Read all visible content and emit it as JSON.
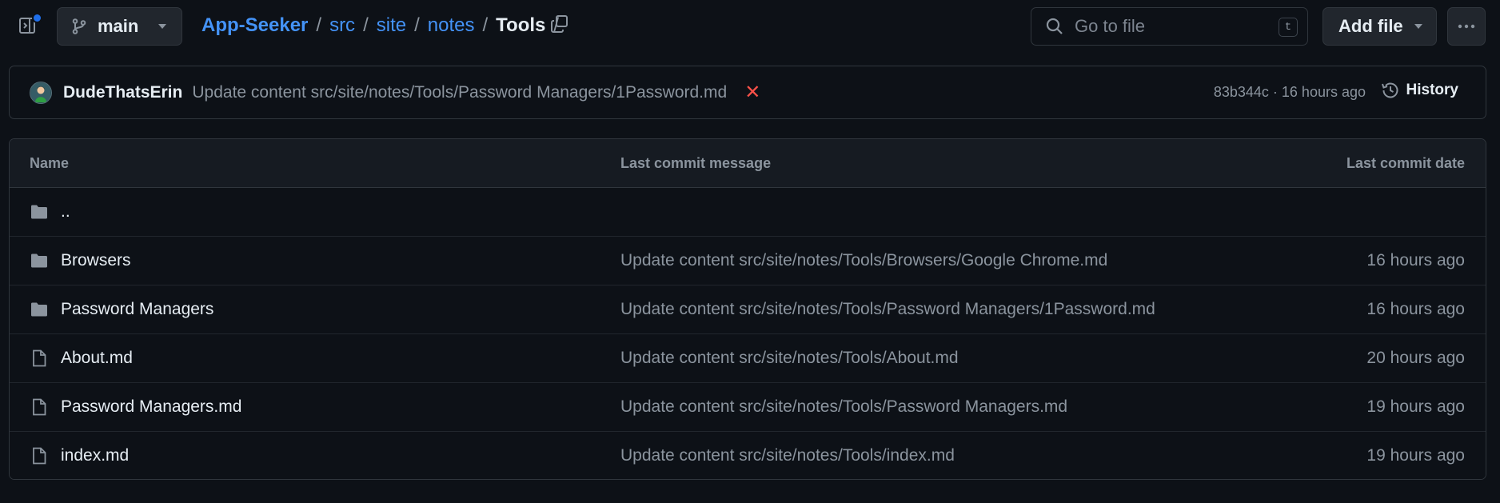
{
  "topbar": {
    "branch": "main",
    "breadcrumb": {
      "repo": "App-Seeker",
      "parts": [
        "src",
        "site",
        "notes"
      ],
      "current": "Tools",
      "sep": "/"
    },
    "goto_placeholder": "Go to file",
    "goto_shortcut": "t",
    "add_file_label": "Add file",
    "accent_color": "#4493f8"
  },
  "commit": {
    "author": "DudeThatsErin",
    "message": "Update content src/site/notes/Tools/Password Managers/1Password.md",
    "status": "✕",
    "meta": "83b344c · 16 hours ago",
    "history_label": "History"
  },
  "table": {
    "headers": {
      "name": "Name",
      "message": "Last commit message",
      "date": "Last commit date"
    },
    "rows": [
      {
        "type": "parent",
        "icon": "folder-icon",
        "name": "..",
        "message": "",
        "date": ""
      },
      {
        "type": "folder",
        "icon": "folder-icon",
        "name": "Browsers",
        "message": "Update content src/site/notes/Tools/Browsers/Google Chrome.md",
        "date": "16 hours ago"
      },
      {
        "type": "folder",
        "icon": "folder-icon",
        "name": "Password Managers",
        "message": "Update content src/site/notes/Tools/Password Managers/1Password.md",
        "date": "16 hours ago"
      },
      {
        "type": "file",
        "icon": "file-icon",
        "name": "About.md",
        "message": "Update content src/site/notes/Tools/About.md",
        "date": "20 hours ago"
      },
      {
        "type": "file",
        "icon": "file-icon",
        "name": "Password Managers.md",
        "message": "Update content src/site/notes/Tools/Password Managers.md",
        "date": "19 hours ago"
      },
      {
        "type": "file",
        "icon": "file-icon",
        "name": "index.md",
        "message": "Update content src/site/notes/Tools/index.md",
        "date": "19 hours ago"
      }
    ]
  }
}
